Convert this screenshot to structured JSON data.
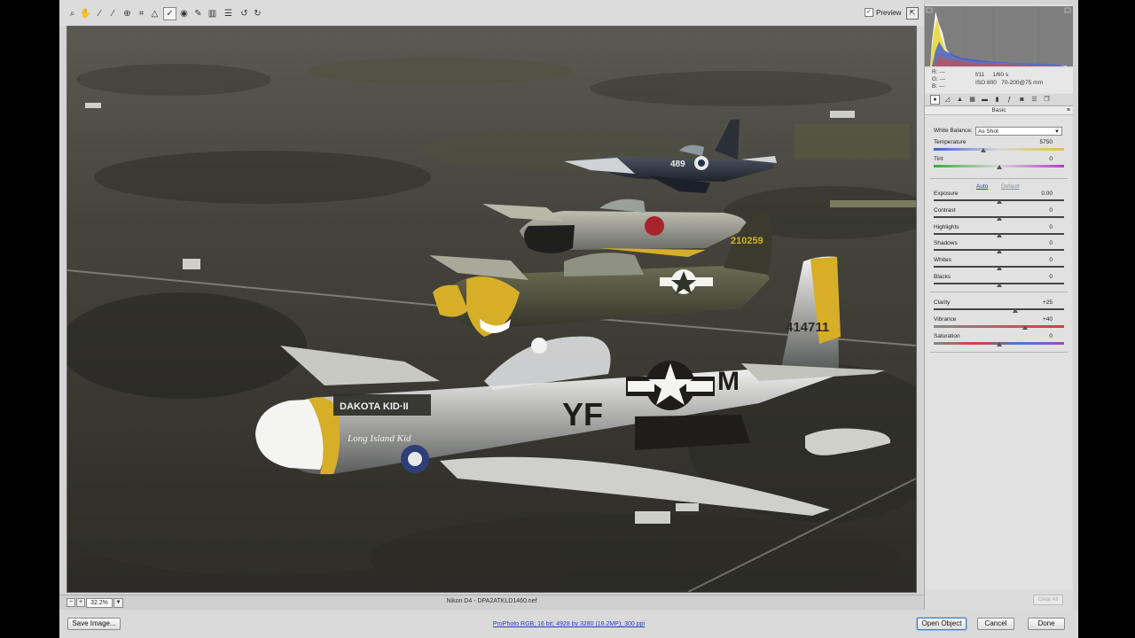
{
  "toolbar": {
    "tools": [
      {
        "name": "zoom-tool-icon",
        "glyph": "⌕"
      },
      {
        "name": "hand-tool-icon",
        "glyph": "✋"
      },
      {
        "name": "white-balance-tool-icon",
        "glyph": "⁄"
      },
      {
        "name": "color-sampler-tool-icon",
        "glyph": "⁄"
      },
      {
        "name": "targeted-adjustment-tool-icon",
        "glyph": "⊕"
      },
      {
        "name": "crop-tool-icon",
        "glyph": "⌗"
      },
      {
        "name": "straighten-tool-icon",
        "glyph": "△"
      },
      {
        "name": "spot-removal-tool-icon",
        "glyph": "✓"
      },
      {
        "name": "red-eye-tool-icon",
        "glyph": "◉"
      },
      {
        "name": "adjustment-brush-icon",
        "glyph": "✎"
      },
      {
        "name": "graduated-filter-icon",
        "glyph": "▥"
      },
      {
        "name": "preferences-icon",
        "glyph": "☰"
      },
      {
        "name": "rotate-left-icon",
        "glyph": "↺"
      },
      {
        "name": "rotate-right-icon",
        "glyph": "↻"
      }
    ],
    "preview_label": "Preview",
    "preview_checked": "✓"
  },
  "status": {
    "zoom_minus": "−",
    "zoom_plus": "+",
    "zoom_value": "32.2%",
    "filename": "Nikon D4  -  DPA2ATKLD1460.nef"
  },
  "bottom": {
    "save_image": "Save Image...",
    "workflow": "ProPhoto RGB; 16 bit; 4928 by 3280 (16.2MP); 300 ppi",
    "open_object": "Open Object",
    "cancel": "Cancel",
    "done": "Done"
  },
  "readout": {
    "r": "R:  ---",
    "g": "G:  ---",
    "b": "B:  ---",
    "aperture": "f/11",
    "shutter": "1/60 s",
    "iso": "ISO 800",
    "lens": "70-200@75 mm"
  },
  "panel": {
    "title": "Basic",
    "menu_icon": "≡",
    "white_balance_label": "White Balance:",
    "white_balance_value": "As Shot",
    "auto": "Auto",
    "default": "Default",
    "clear_all": "Clear All",
    "sliders": [
      {
        "key": "temperature",
        "label": "Temperature",
        "value": "5750",
        "pos": 0.38
      },
      {
        "key": "tint",
        "label": "Tint",
        "value": "0",
        "pos": 0.5
      },
      {
        "key": "exposure",
        "label": "Exposure",
        "value": "0.00",
        "pos": 0.5
      },
      {
        "key": "contrast",
        "label": "Contrast",
        "value": "0",
        "pos": 0.5
      },
      {
        "key": "highlights",
        "label": "Highlights",
        "value": "0",
        "pos": 0.5
      },
      {
        "key": "shadows",
        "label": "Shadows",
        "value": "0",
        "pos": 0.5
      },
      {
        "key": "whites",
        "label": "Whites",
        "value": "0",
        "pos": 0.5
      },
      {
        "key": "blacks",
        "label": "Blacks",
        "value": "0",
        "pos": 0.5
      },
      {
        "key": "clarity",
        "label": "Clarity",
        "value": "+25",
        "pos": 0.625
      },
      {
        "key": "vibrance",
        "label": "Vibrance",
        "value": "+40",
        "pos": 0.7
      },
      {
        "key": "saturation",
        "label": "Saturation",
        "value": "0",
        "pos": 0.5
      }
    ]
  },
  "photo": {
    "plane_1_code": "489",
    "plane_3_serial": "210259",
    "plane_4_serial": "414711",
    "plane_4_code_left": "YF",
    "plane_4_code_right": "M",
    "plane_4_name": "DAKOTA KID·II",
    "plane_4_script": "Long Island Kid"
  },
  "colors": {
    "app_bg": "#d4d4d4",
    "ground": "#3b3a33",
    "yellow": "#d6ae28",
    "link": "#1f43b0"
  }
}
